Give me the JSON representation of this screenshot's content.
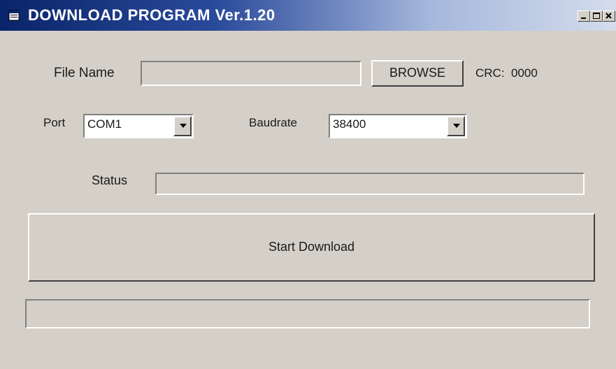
{
  "window": {
    "title": "DOWNLOAD PROGRAM Ver.1.20",
    "title_icon": "app-icon",
    "minimize_icon": "minimize-icon",
    "maximize_icon": "maximize-icon",
    "close_icon": "close-icon"
  },
  "file": {
    "label": "File Name",
    "value": "",
    "browse_label": "BROWSE"
  },
  "crc": {
    "label": "CRC:",
    "value": "0000"
  },
  "port": {
    "label": "Port",
    "selected": "COM1"
  },
  "baudrate": {
    "label": "Baudrate",
    "selected": "38400"
  },
  "status": {
    "label": "Status",
    "value": ""
  },
  "actions": {
    "start_download_label": "Start Download"
  },
  "progress": {
    "value": 0
  },
  "colors": {
    "window_bg": "#d4d0c8",
    "titlebar_start": "#0a246a",
    "titlebar_end": "#d4dcec"
  }
}
